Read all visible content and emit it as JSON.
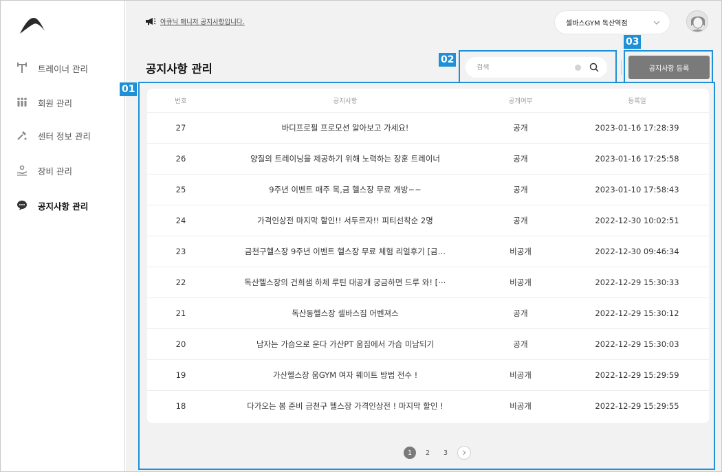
{
  "sidebar": {
    "items": [
      {
        "label": "트레이너 관리",
        "icon": "dumbbell-icon"
      },
      {
        "label": "회원 관리",
        "icon": "people-icon"
      },
      {
        "label": "센터 정보 관리",
        "icon": "tools-icon"
      },
      {
        "label": "장비 관리",
        "icon": "hand-equipment-icon"
      },
      {
        "label": "공지사항 관리",
        "icon": "chat-bubble-icon"
      }
    ],
    "active_index": 4
  },
  "header": {
    "notice_text": "아큐닉 매니저 공지사항입니다.",
    "gym_select_value": "셀바스GYM 독산역점"
  },
  "page": {
    "title": "공지사항 관리",
    "search_placeholder": "검색",
    "register_label": "공지사항 등록"
  },
  "annotations": {
    "table_tag": "01",
    "search_tag": "02",
    "register_tag": "03"
  },
  "table": {
    "headers": {
      "no": "번호",
      "title": "공지사항",
      "public": "공개여부",
      "date": "등록일"
    },
    "rows": [
      {
        "no": "27",
        "title": "바디프로필 프로모션 알아보고 가세요!",
        "public": "공개",
        "date": "2023-01-16 17:28:39"
      },
      {
        "no": "26",
        "title": "양질의 트레이닝을 제공하기 위해 노력하는 장훈 트레이너",
        "public": "공개",
        "date": "2023-01-16 17:25:58"
      },
      {
        "no": "25",
        "title": "9주년 이벤트 매주 목,금 헬스장 무료 개방~~",
        "public": "공개",
        "date": "2023-01-10 17:58:43"
      },
      {
        "no": "24",
        "title": "가격인상전 마지막 할인!! 서두르자!! 피티선착순 2명",
        "public": "공개",
        "date": "2022-12-30 10:02:51"
      },
      {
        "no": "23",
        "title": "금천구헬스장 9주년 이벤트 헬스장 무료 체험 리얼후기 [금…",
        "public": "비공개",
        "date": "2022-12-30 09:46:34"
      },
      {
        "no": "22",
        "title": "독산헬스장의 건희샘 하체 루틴 대공개 궁금하면 드루 와! [⋯",
        "public": "비공개",
        "date": "2022-12-29 15:30:33"
      },
      {
        "no": "21",
        "title": "독산동헬스장 셀바스짐 어벤져스",
        "public": "공개",
        "date": "2022-12-29 15:30:12"
      },
      {
        "no": "20",
        "title": "남자는 가슴으로 운다 가산PT 움짐에서 가슴 미남되기",
        "public": "공개",
        "date": "2022-12-29 15:30:03"
      },
      {
        "no": "19",
        "title": "가산헬스장 움GYM 여자 웨이트 방법 전수 !",
        "public": "비공개",
        "date": "2022-12-29 15:29:59"
      },
      {
        "no": "18",
        "title": "다가오는 봄 준비 금천구 헬스장 가격인상전 ! 마지막 할인 !",
        "public": "비공개",
        "date": "2022-12-29 15:29:55"
      }
    ]
  },
  "pagination": {
    "pages": [
      "1",
      "2",
      "3"
    ],
    "current": "1"
  },
  "colors": {
    "accent_highlight": "#1e90d6",
    "button_gray": "#7a7a7a",
    "background": "#f2f2f2"
  }
}
